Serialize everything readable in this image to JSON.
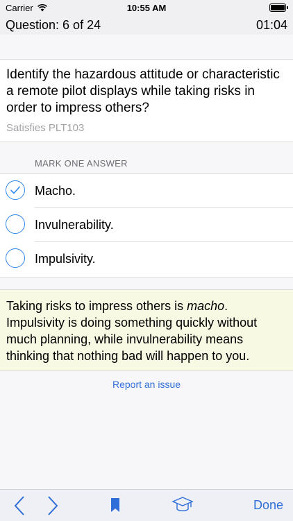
{
  "status_bar": {
    "carrier": "Carrier",
    "time": "10:55 AM"
  },
  "header": {
    "question_label": "Question: 6 of 24",
    "timer": "01:04"
  },
  "question": {
    "text": "Identify the hazardous attitude or characteristic a remote pilot displays while taking risks in order to impress others?",
    "satisfies": "Satisfies PLT103"
  },
  "answers_section": {
    "label": "MARK ONE ANSWER",
    "options": [
      {
        "label": "Macho.",
        "selected": true
      },
      {
        "label": "Invulnerability.",
        "selected": false
      },
      {
        "label": "Impulsivity.",
        "selected": false
      }
    ]
  },
  "explanation": {
    "part1": "Taking risks to impress others is ",
    "emphasis": "macho",
    "part2": ". Impulsivity is doing something quickly without much planning, while invulnerability means thinking that nothing bad will happen to you."
  },
  "report_link": "Report an issue",
  "toolbar": {
    "done_label": "Done",
    "icons": [
      "chevron-left-icon",
      "chevron-right-icon",
      "bookmark-icon",
      "graduation-cap-icon"
    ]
  },
  "colors": {
    "accent": "#2f6ed8",
    "explanation_bg": "#f8f9e2"
  }
}
